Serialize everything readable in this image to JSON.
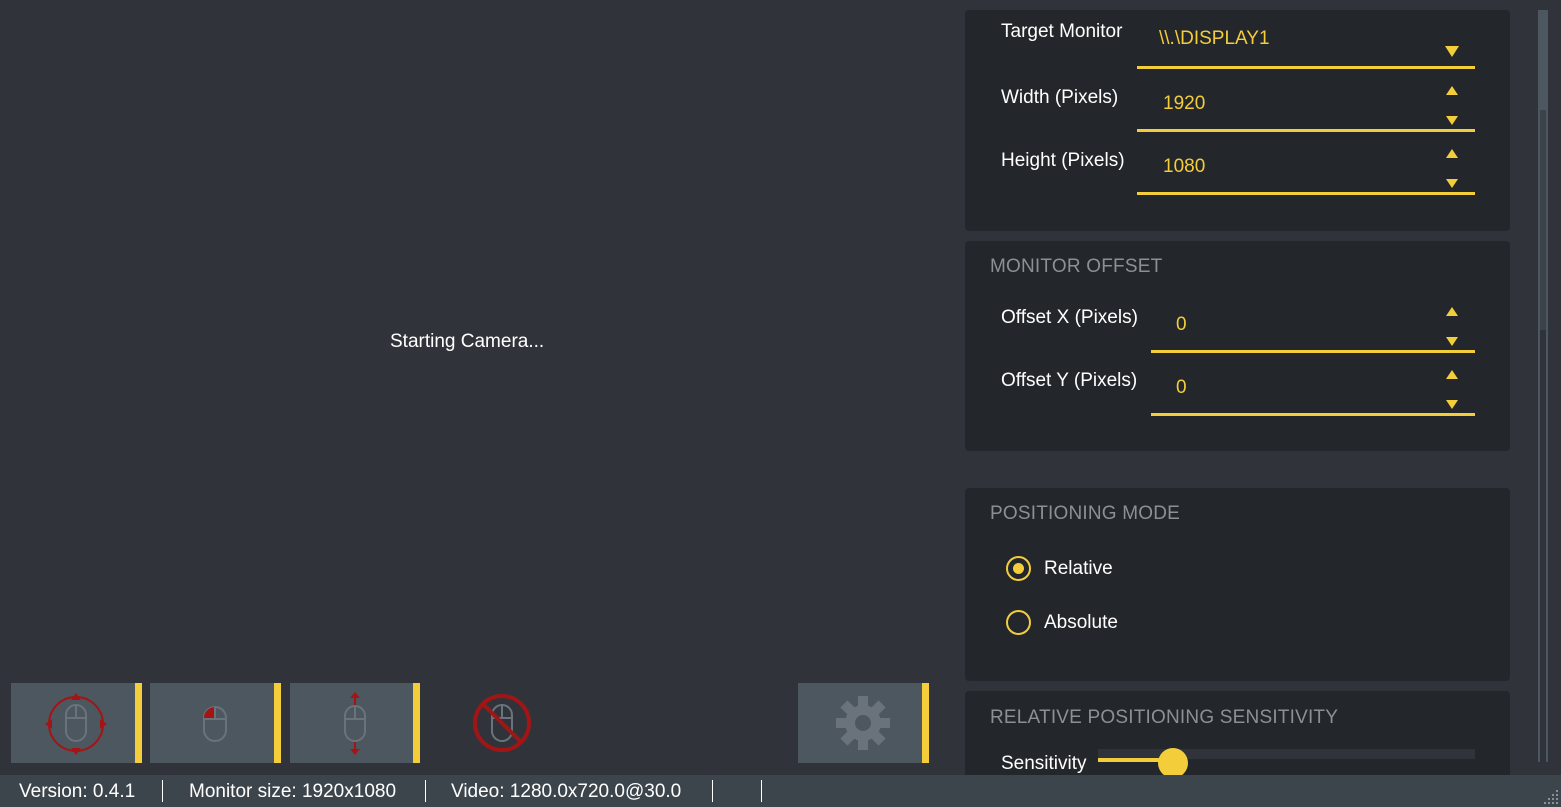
{
  "camera": {
    "status": "Starting Camera..."
  },
  "toolbar": {
    "buttons": [
      {
        "name": "move-cursor",
        "icon": "mouse-move-icon"
      },
      {
        "name": "left-click",
        "icon": "mouse-left-click-icon"
      },
      {
        "name": "scroll",
        "icon": "mouse-scroll-icon"
      },
      {
        "name": "disable-mouse",
        "icon": "mouse-disabled-icon"
      },
      {
        "name": "settings",
        "icon": "gear-icon"
      }
    ]
  },
  "monitor": {
    "target_label": "Target Monitor",
    "target_value": "\\\\.\\DISPLAY1",
    "width_label": "Width (Pixels)",
    "width_value": "1920",
    "height_label": "Height (Pixels)",
    "height_value": "1080"
  },
  "offset": {
    "title": "MONITOR OFFSET",
    "x_label": "Offset X (Pixels)",
    "x_value": "0",
    "y_label": "Offset Y (Pixels)",
    "y_value": "0"
  },
  "positioning": {
    "title": "POSITIONING MODE",
    "options": [
      {
        "label": "Relative",
        "selected": true
      },
      {
        "label": "Absolute",
        "selected": false
      }
    ]
  },
  "sensitivity": {
    "title": "RELATIVE POSITIONING SENSITIVITY",
    "label": "Sensitivity",
    "level": 0.2
  },
  "status_bar": {
    "version": "Version: 0.4.1",
    "monitor_size": "Monitor size: 1920x1080",
    "video": "Video: 1280.0x720.0@30.0"
  },
  "colors": {
    "accent": "#f4cd3a",
    "background": "#30343a",
    "card": "#23272b",
    "button": "#4d575f",
    "icon_red": "#a31515"
  }
}
